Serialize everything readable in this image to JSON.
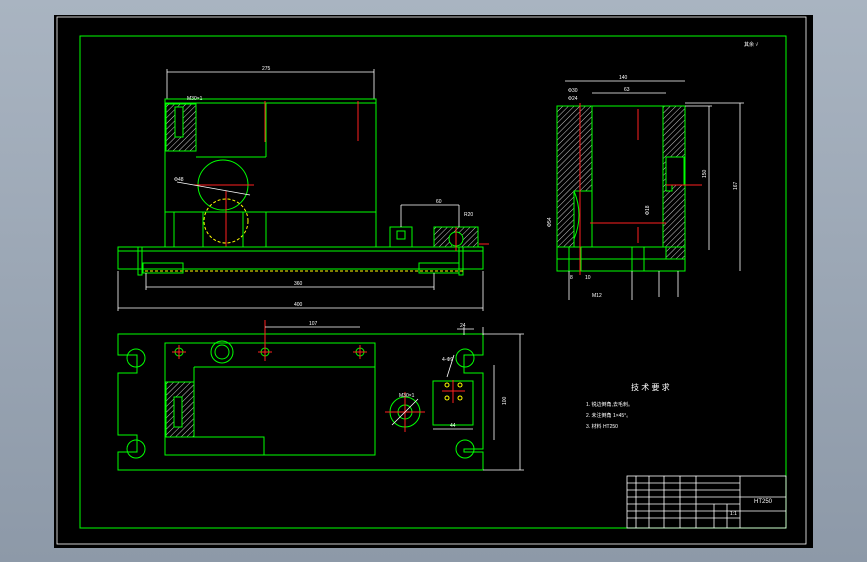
{
  "notes": {
    "title": "技 术 要 求",
    "items": [
      "1. 锐边倒角,去毛刺。",
      "2. 未注倒角 1×45°。",
      "3. 材料 HT250"
    ]
  },
  "roughness_mark": "其余 √",
  "dims": {
    "top_width": "275",
    "bottom_len": "360",
    "overall": "400",
    "front_mid": "60",
    "r20": "R20",
    "m30": "M30×1",
    "phi48": "Φ48",
    "side_top": "140",
    "side_63": "63",
    "side_phi30": "Φ30",
    "side_phi24": "Φ24",
    "side_h1": "150",
    "side_h2": "167",
    "side_phi54": "Φ54",
    "side_phi18": "Φ18",
    "side_8": "8",
    "side_10": "10",
    "side_bottom": "M12",
    "plan_107": "107",
    "plan_24": "24",
    "plan_4phi9": "4-Φ9",
    "plan_44": "44",
    "plan_100": "100",
    "plan_m30": "M30×1"
  },
  "title_block": {
    "tag": "HT250",
    "scale": "1:1"
  }
}
